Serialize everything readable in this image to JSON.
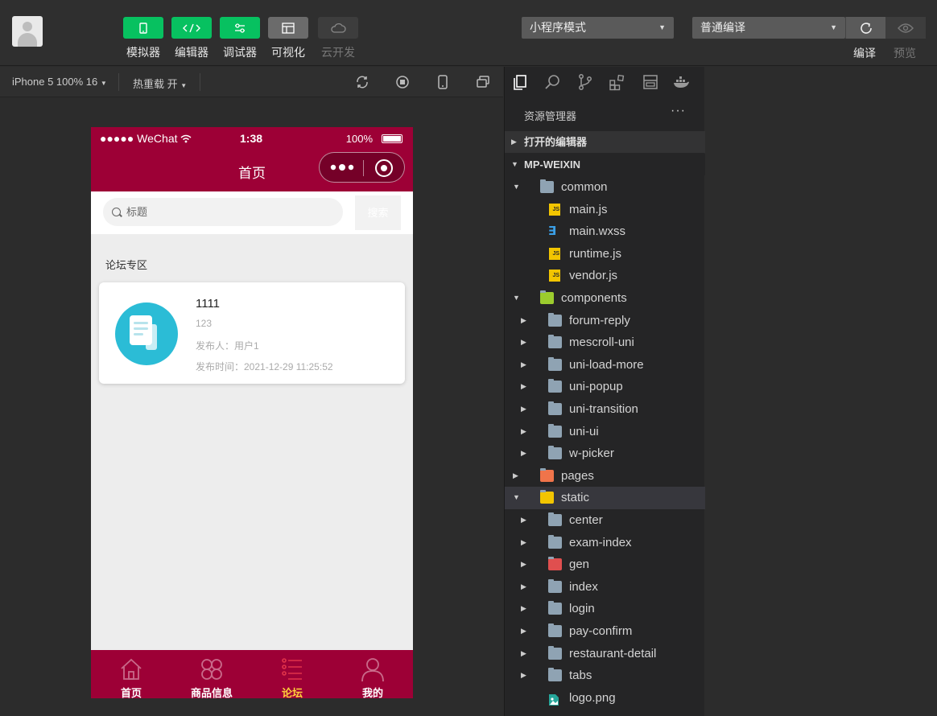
{
  "toolbar": {
    "tools": [
      {
        "label": "模拟器",
        "icon": "phone-icon"
      },
      {
        "label": "编辑器",
        "icon": "code-icon"
      },
      {
        "label": "调试器",
        "icon": "debug-icon"
      },
      {
        "label": "可视化",
        "icon": "layout-icon"
      },
      {
        "label": "云开发",
        "icon": "cloud-icon"
      }
    ],
    "mode_select": "小程序模式",
    "compile_select": "普通编译",
    "compile_label": "编译",
    "preview_label": "预览"
  },
  "simbar": {
    "device": "iPhone 5 100% 16",
    "hot_reload": "热重载 开"
  },
  "phone": {
    "carrier": "●●●●● WeChat",
    "time": "1:38",
    "battery": "100%",
    "nav_title": "首页",
    "search_placeholder": "标题",
    "search_button": "搜索",
    "section_title": "论坛专区",
    "post": {
      "title": "1111",
      "desc": "123",
      "user": "发布人：用户1",
      "time": "发布时间：2021-12-29 11:25:52"
    },
    "tabs": [
      {
        "label": "首页",
        "icon": "home-icon",
        "active": false
      },
      {
        "label": "商品信息",
        "icon": "grid-icon",
        "active": false
      },
      {
        "label": "论坛",
        "icon": "list-icon",
        "active": true
      },
      {
        "label": "我的",
        "icon": "user-icon",
        "active": false
      }
    ]
  },
  "explorer": {
    "title": "资源管理器",
    "more": "···",
    "open_editors": "打开的编辑器",
    "project": "MP-WEIXIN",
    "tree": [
      {
        "name": "common",
        "depth": 1,
        "type": "folder-open",
        "arrow": "▼"
      },
      {
        "name": "main.js",
        "depth": 2,
        "type": "js",
        "arrow": ""
      },
      {
        "name": "main.wxss",
        "depth": 2,
        "type": "css",
        "arrow": ""
      },
      {
        "name": "runtime.js",
        "depth": 2,
        "type": "js",
        "arrow": ""
      },
      {
        "name": "vendor.js",
        "depth": 2,
        "type": "js",
        "arrow": ""
      },
      {
        "name": "components",
        "depth": 1,
        "type": "folder-green",
        "arrow": "▼"
      },
      {
        "name": "forum-reply",
        "depth": 2,
        "type": "folder",
        "arrow": "▶"
      },
      {
        "name": "mescroll-uni",
        "depth": 2,
        "type": "folder",
        "arrow": "▶"
      },
      {
        "name": "uni-load-more",
        "depth": 2,
        "type": "folder",
        "arrow": "▶"
      },
      {
        "name": "uni-popup",
        "depth": 2,
        "type": "folder",
        "arrow": "▶"
      },
      {
        "name": "uni-transition",
        "depth": 2,
        "type": "folder",
        "arrow": "▶"
      },
      {
        "name": "uni-ui",
        "depth": 2,
        "type": "folder",
        "arrow": "▶"
      },
      {
        "name": "w-picker",
        "depth": 2,
        "type": "folder",
        "arrow": "▶"
      },
      {
        "name": "pages",
        "depth": 1,
        "type": "folder-orange",
        "arrow": "▶"
      },
      {
        "name": "static",
        "depth": 1,
        "type": "folder-yellow",
        "arrow": "▼",
        "selected": true
      },
      {
        "name": "center",
        "depth": 2,
        "type": "folder",
        "arrow": "▶"
      },
      {
        "name": "exam-index",
        "depth": 2,
        "type": "folder",
        "arrow": "▶"
      },
      {
        "name": "gen",
        "depth": 2,
        "type": "folder-red",
        "arrow": "▶"
      },
      {
        "name": "index",
        "depth": 2,
        "type": "folder",
        "arrow": "▶"
      },
      {
        "name": "login",
        "depth": 2,
        "type": "folder",
        "arrow": "▶"
      },
      {
        "name": "pay-confirm",
        "depth": 2,
        "type": "folder",
        "arrow": "▶"
      },
      {
        "name": "restaurant-detail",
        "depth": 2,
        "type": "folder",
        "arrow": "▶"
      },
      {
        "name": "tabs",
        "depth": 2,
        "type": "folder",
        "arrow": "▶"
      },
      {
        "name": "logo.png",
        "depth": 2,
        "type": "image",
        "arrow": ""
      }
    ]
  },
  "colors": {
    "brand": "#9d0036",
    "green": "#07c160",
    "active_tab": "#ffd23a",
    "thumb": "#2bbcd6"
  }
}
